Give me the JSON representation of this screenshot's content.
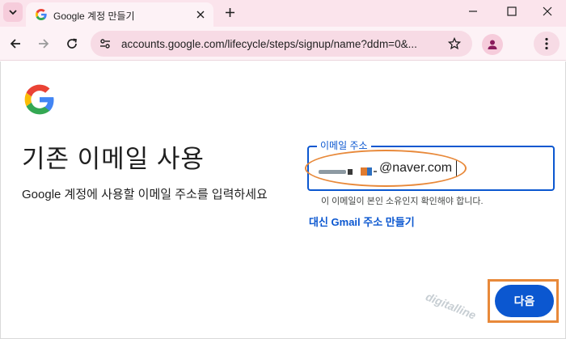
{
  "browser": {
    "tab": {
      "title": "Google 계정 만들기",
      "favicon": "google-g-icon"
    },
    "address_bar": {
      "url": "accounts.google.com/lifecycle/steps/signup/name?ddm=0&..."
    },
    "icons": {
      "tab_search": "chevron-down-icon",
      "tab_close": "close-icon",
      "new_tab": "plus-icon",
      "minimize": "minimize-icon",
      "maximize": "maximize-icon",
      "close_window": "close-icon",
      "back": "arrow-left-icon",
      "forward": "arrow-right-icon",
      "reload": "reload-icon",
      "site_info": "tune-icon",
      "bookmark": "star-icon",
      "profile": "person-icon",
      "menu": "kebab-menu-icon"
    },
    "colors": {
      "tab_strip": "#fbe4ec",
      "toolbar": "#fdf2f6",
      "omnibox": "#f7dbe5"
    }
  },
  "page": {
    "heading": "기존 이메일 사용",
    "description": "Google 계정에 사용할 이메일 주소를 입력하세요",
    "email_field": {
      "label": "이메일 주소",
      "value_visible": "@naver.com",
      "hint": "이 이메일이 본인 소유인지 확인해야 합니다."
    },
    "gmail_link": "대신 Gmail 주소 만들기",
    "next_button": "다음",
    "watermark": "digitalline",
    "colors": {
      "accent": "#0b57d0",
      "annotation": "#e8893a"
    }
  }
}
